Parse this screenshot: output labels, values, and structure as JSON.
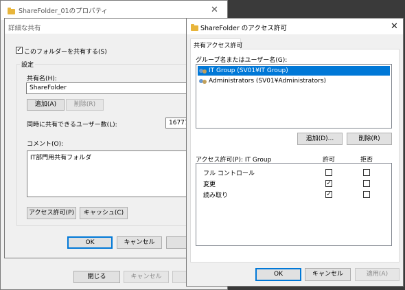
{
  "back_window": {
    "title": "ShareFolder_01のプロパティ",
    "close_glyph": "✕",
    "buttons": {
      "close": "閉じる",
      "cancel": "キャンセル"
    }
  },
  "advanced_sharing": {
    "title": "詳細な共有",
    "share_checkbox_label": "このフォルダーを共有する(S)",
    "share_checkbox_checked": true,
    "settings_label": "設定",
    "share_name_label": "共有名(H):",
    "share_name_value": "ShareFolder",
    "add_button": "追加(A)",
    "remove_button": "削除(R)",
    "user_limit_label": "同時に共有できるユーザー数(L):",
    "user_limit_value": "16777",
    "comment_label": "コメント(O):",
    "comment_value": "IT部門用共有フォルダ",
    "permissions_button": "アクセス許可(P)",
    "caching_button": "キャッシュ(C)",
    "ok_button": "OK",
    "cancel_button": "キャンセル"
  },
  "permissions_dialog": {
    "title": "ShareFolder のアクセス許可",
    "close_glyph": "✕",
    "tab_label": "共有アクセス許可",
    "groups_label": "グループ名またはユーザー名(G):",
    "groups": [
      {
        "name": "IT Group (SV01¥IT Group)",
        "selected": true,
        "icon": "group-icon"
      },
      {
        "name": "Administrators (SV01¥Administrators)",
        "selected": false,
        "icon": "group-icon"
      }
    ],
    "add_button": "追加(D)...",
    "remove_button": "削除(R)",
    "permissions_for_label": "アクセス許可(P): IT Group",
    "allow_header": "許可",
    "deny_header": "拒否",
    "permissions": [
      {
        "name": "フル コントロール",
        "allow": false,
        "deny": false
      },
      {
        "name": "変更",
        "allow": true,
        "deny": false
      },
      {
        "name": "読み取り",
        "allow": true,
        "deny": false
      }
    ],
    "ok_button": "OK",
    "cancel_button": "キャンセル",
    "apply_button": "適用(A)"
  },
  "colors": {
    "selection": "#0078d7",
    "check_mark": "#333333"
  }
}
